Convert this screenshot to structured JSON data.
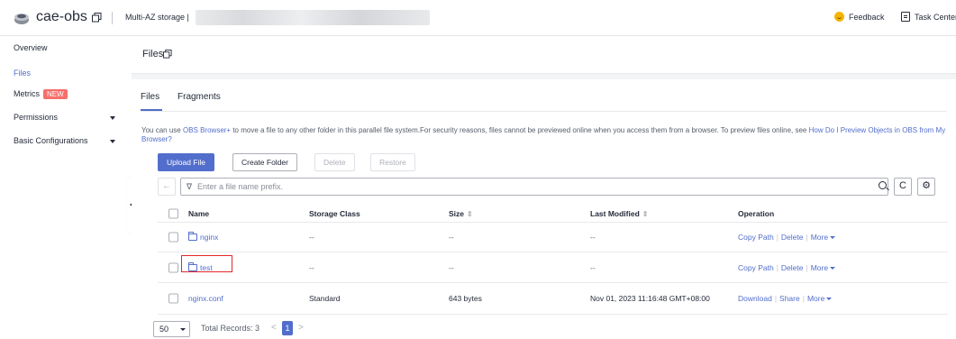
{
  "topbar": {
    "brand": "cae-obs",
    "breadcrumb": "Multi-AZ storage |",
    "feedback": "Feedback",
    "task_center": "Task Center"
  },
  "sidebar": {
    "items": [
      {
        "label": "Overview"
      },
      {
        "label": "Files",
        "active": true
      },
      {
        "label": "Metrics",
        "badge": "NEW"
      },
      {
        "label": "Permissions",
        "expandable": true
      },
      {
        "label": "Basic Configurations",
        "expandable": true
      }
    ]
  },
  "page": {
    "title": "Files"
  },
  "tabs": [
    {
      "label": "Files",
      "active": true
    },
    {
      "label": "Fragments"
    }
  ],
  "info": {
    "prefix": "You can use ",
    "link1": "OBS Browser+",
    "middle": " to move a file to any other folder in this parallel file system.For security reasons, files cannot be previewed online when you access them from a browser. To preview files online, see ",
    "link2": "How Do I Preview Objects in OBS from My Browser?"
  },
  "toolbar": {
    "upload": "Upload File",
    "create_folder": "Create Folder",
    "delete": "Delete",
    "restore": "Restore",
    "back_icon": "←",
    "search_placeholder": "Enter a file name prefix.",
    "filter_icon": "∇",
    "refresh_icon": "C",
    "settings_icon": "⚙"
  },
  "table": {
    "columns": {
      "name": "Name",
      "storage_class": "Storage Class",
      "size": "Size",
      "last_modified": "Last Modified",
      "operation": "Operation"
    },
    "rows": [
      {
        "name": "nginx",
        "type": "folder",
        "storage_class": "--",
        "size": "--",
        "last_modified": "--",
        "ops": [
          "Copy Path",
          "Delete",
          "More"
        ]
      },
      {
        "name": "test",
        "type": "folder",
        "storage_class": "--",
        "size": "--",
        "last_modified": "--",
        "ops": [
          "Copy Path",
          "Delete",
          "More"
        ]
      },
      {
        "name": "nginx.conf",
        "type": "file",
        "storage_class": "Standard",
        "size": "643 bytes",
        "last_modified": "Nov 01, 2023 11:16:48 GMT+08:00",
        "ops": [
          "Download",
          "Share",
          "More"
        ]
      }
    ]
  },
  "pagination": {
    "page_size": "50",
    "total": "Total Records: 3",
    "current_page": "1",
    "prev": "<",
    "next": ">"
  },
  "colors": {
    "accent": "#526ecc",
    "badge": "#f66f6a",
    "highlight": "#e3262a"
  }
}
